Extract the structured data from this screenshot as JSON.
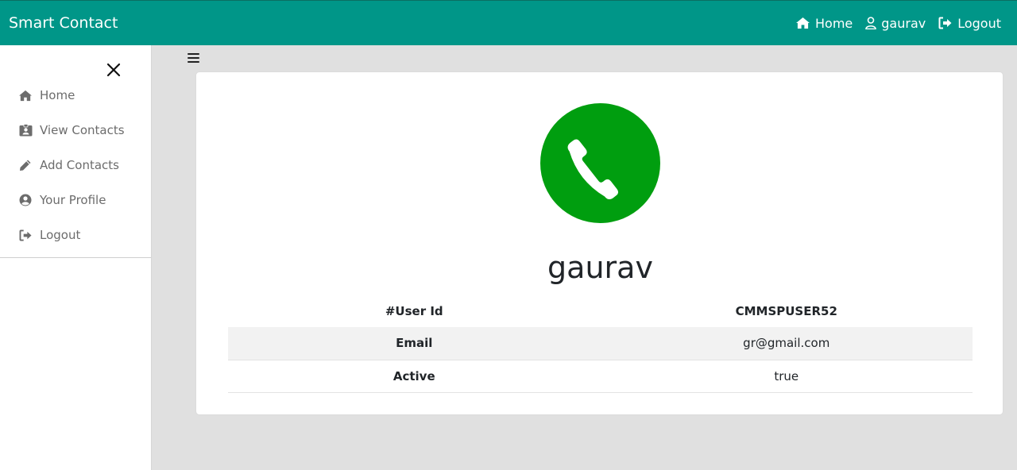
{
  "navbar": {
    "brand": "Smart Contact",
    "links": [
      {
        "label": "Home",
        "icon": "home-icon"
      },
      {
        "label": "gaurav",
        "icon": "user-icon"
      },
      {
        "label": "Logout",
        "icon": "logout-icon"
      }
    ]
  },
  "sidebar": {
    "items": [
      {
        "label": "Home",
        "icon": "home-icon"
      },
      {
        "label": "View Contacts",
        "icon": "id-card-icon"
      },
      {
        "label": "Add Contacts",
        "icon": "pencil-icon"
      },
      {
        "label": "Your Profile",
        "icon": "user-circle-icon"
      },
      {
        "label": "Logout",
        "icon": "logout-icon"
      }
    ]
  },
  "profile": {
    "name": "gaurav",
    "avatar_icon": "phone-icon",
    "avatar_color": "#009e0f",
    "rows": [
      {
        "key": "#User Id",
        "value": "CMMSPUSER52"
      },
      {
        "key": "Email",
        "value": "gr@gmail.com"
      },
      {
        "key": "Active",
        "value": "true"
      }
    ]
  },
  "colors": {
    "navbar": "#009688",
    "background": "#e0e0e0"
  }
}
